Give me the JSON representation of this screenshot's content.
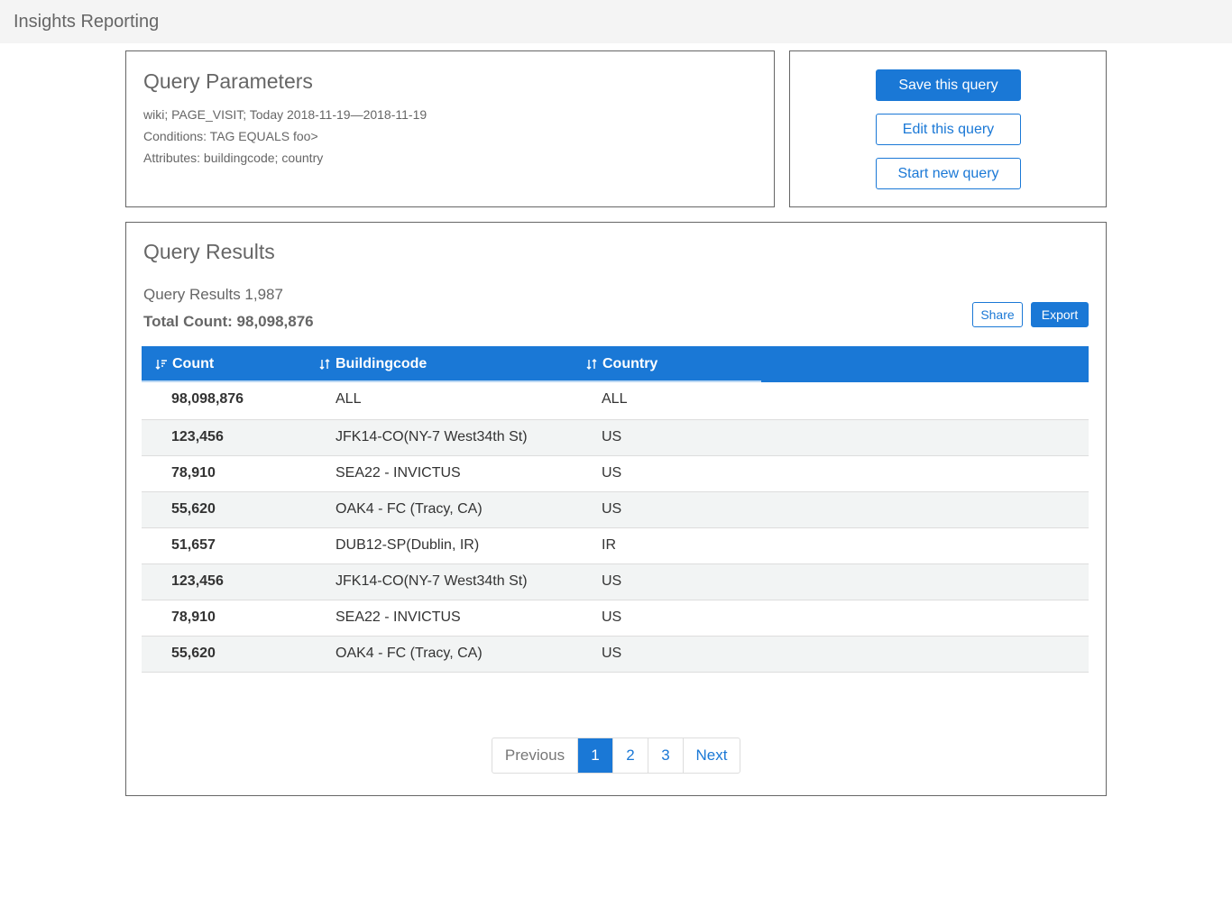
{
  "app": {
    "title": "Insights Reporting"
  },
  "params": {
    "title": "Query Parameters",
    "lines": [
      "wiki; PAGE_VISIT; Today 2018-11-19—2018-11-19",
      "Conditions: TAG EQUALS foo>",
      "Attributes: buildingcode; country"
    ]
  },
  "actions": {
    "save": "Save this query",
    "edit": "Edit this query",
    "start": "Start new query"
  },
  "results": {
    "title": "Query Results",
    "subtitle": "Query Results 1,987",
    "total": "Total Count: 98,098,876",
    "share": "Share",
    "export": "Export",
    "columns": [
      "Count",
      "Buildingcode",
      "Country"
    ],
    "rows": [
      {
        "count": "98,098,876",
        "buildingcode": "ALL",
        "country": "ALL"
      },
      {
        "count": "123,456",
        "buildingcode": "JFK14-CO(NY-7 West34th St)",
        "country": "US"
      },
      {
        "count": "78,910",
        "buildingcode": "SEA22 - INVICTUS",
        "country": "US"
      },
      {
        "count": "55,620",
        "buildingcode": "OAK4 - FC (Tracy, CA)",
        "country": "US"
      },
      {
        "count": "51,657",
        "buildingcode": "DUB12-SP(Dublin, IR)",
        "country": "IR"
      },
      {
        "count": "123,456",
        "buildingcode": "JFK14-CO(NY-7 West34th St)",
        "country": "US"
      },
      {
        "count": "78,910",
        "buildingcode": "SEA22 - INVICTUS",
        "country": "US"
      },
      {
        "count": "55,620",
        "buildingcode": "OAK4 - FC (Tracy, CA)",
        "country": "US"
      }
    ]
  },
  "pagination": {
    "previous": "Previous",
    "pages": [
      "1",
      "2",
      "3"
    ],
    "active_page": "1",
    "next": "Next"
  },
  "colors": {
    "accent": "#1a78d6",
    "stripe": "#f2f4f4",
    "border": "#666666"
  }
}
